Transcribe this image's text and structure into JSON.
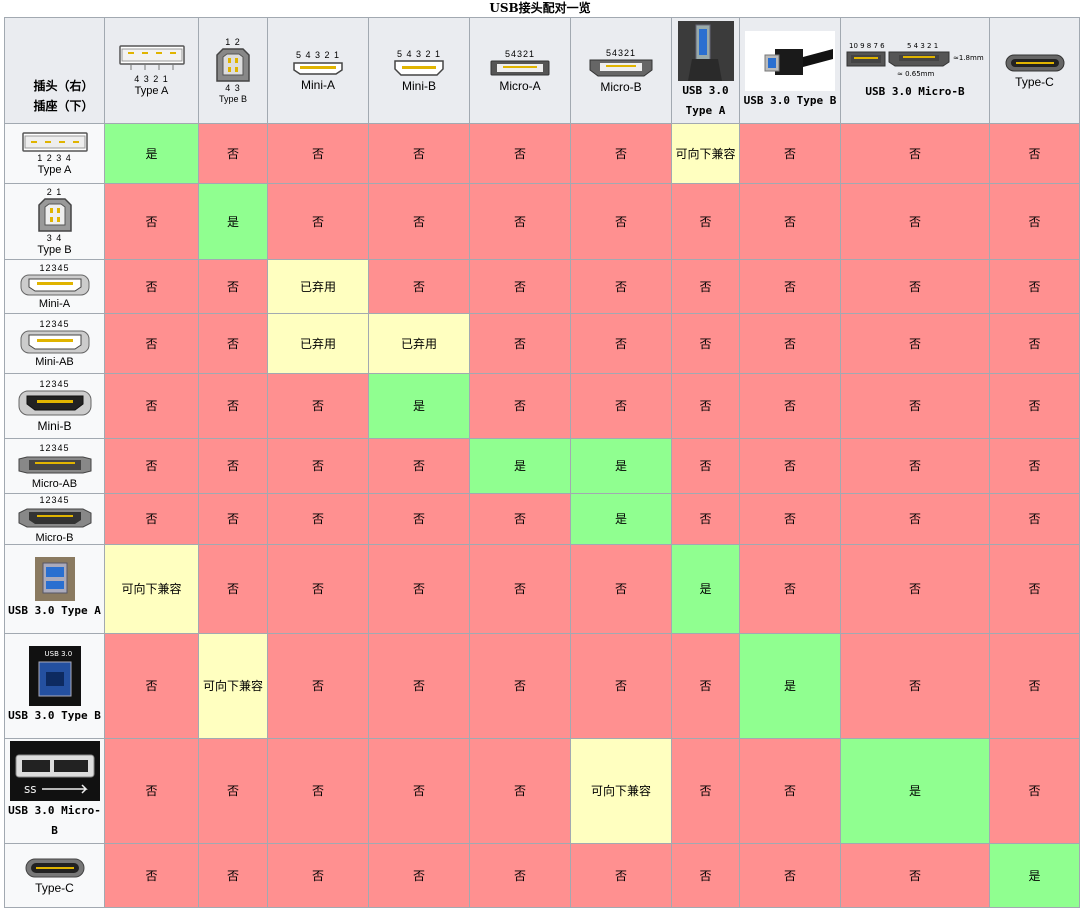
{
  "caption": "USB接头配对一览",
  "corner": {
    "line1": "插头（右）",
    "line2": "插座（下）"
  },
  "columns": [
    {
      "label": "Type A",
      "pins": "4 3 2 1",
      "icon": "usb-type-a-plug-icon"
    },
    {
      "label": "Type B",
      "pins_top": "1 2",
      "pins_bottom": "4 3",
      "icon": "usb-type-b-plug-icon"
    },
    {
      "label": "Mini-A",
      "pins": "5 4 3 2 1",
      "icon": "usb-mini-a-plug-icon"
    },
    {
      "label": "Mini-B",
      "pins": "5 4 3 2 1",
      "icon": "usb-mini-b-plug-icon"
    },
    {
      "label": "Micro-A",
      "pins": "54321",
      "icon": "usb-micro-a-plug-icon"
    },
    {
      "label": "Micro-B",
      "pins": "54321",
      "icon": "usb-micro-b-plug-icon"
    },
    {
      "label": "USB 3.0 Type A",
      "icon": "usb3-type-a-plug-photo"
    },
    {
      "label": "USB 3.0 Type B",
      "icon": "usb3-type-b-plug-photo"
    },
    {
      "label": "USB 3.0 Micro-B",
      "pins_left": "10 9 8 7 6",
      "pins_right": "5 4 3 2 1",
      "dim1": "≈1.8mm",
      "dim2": "≈ 0.65mm",
      "icon": "usb3-micro-b-plug-icon"
    },
    {
      "label": "Type-C",
      "icon": "usb-type-c-plug-icon"
    }
  ],
  "rows": [
    {
      "label": "Type A",
      "pins": "1 2 3 4",
      "icon": "usb-type-a-receptacle-icon",
      "cells": [
        [
          "是",
          "yes"
        ],
        [
          "否",
          "no"
        ],
        [
          "否",
          "no"
        ],
        [
          "否",
          "no"
        ],
        [
          "否",
          "no"
        ],
        [
          "否",
          "no"
        ],
        [
          "可向下兼容",
          "back"
        ],
        [
          "否",
          "no"
        ],
        [
          "否",
          "no"
        ],
        [
          "否",
          "no"
        ]
      ]
    },
    {
      "label": "Type B",
      "pins_top": "2 1",
      "pins_bottom": "3 4",
      "icon": "usb-type-b-receptacle-icon",
      "cells": [
        [
          "否",
          "no"
        ],
        [
          "是",
          "yes"
        ],
        [
          "否",
          "no"
        ],
        [
          "否",
          "no"
        ],
        [
          "否",
          "no"
        ],
        [
          "否",
          "no"
        ],
        [
          "否",
          "no"
        ],
        [
          "否",
          "no"
        ],
        [
          "否",
          "no"
        ],
        [
          "否",
          "no"
        ]
      ]
    },
    {
      "label": "Mini-A",
      "pins": "12345",
      "icon": "usb-mini-a-receptacle-icon",
      "cells": [
        [
          "否",
          "no"
        ],
        [
          "否",
          "no"
        ],
        [
          "已弃用",
          "depr"
        ],
        [
          "否",
          "no"
        ],
        [
          "否",
          "no"
        ],
        [
          "否",
          "no"
        ],
        [
          "否",
          "no"
        ],
        [
          "否",
          "no"
        ],
        [
          "否",
          "no"
        ],
        [
          "否",
          "no"
        ]
      ]
    },
    {
      "label": "Mini-AB",
      "pins": "12345",
      "icon": "usb-mini-ab-receptacle-icon",
      "cells": [
        [
          "否",
          "no"
        ],
        [
          "否",
          "no"
        ],
        [
          "已弃用",
          "depr"
        ],
        [
          "已弃用",
          "depr"
        ],
        [
          "否",
          "no"
        ],
        [
          "否",
          "no"
        ],
        [
          "否",
          "no"
        ],
        [
          "否",
          "no"
        ],
        [
          "否",
          "no"
        ],
        [
          "否",
          "no"
        ]
      ]
    },
    {
      "label": "Mini-B",
      "pins": "12345",
      "icon": "usb-mini-b-receptacle-icon",
      "cells": [
        [
          "否",
          "no"
        ],
        [
          "否",
          "no"
        ],
        [
          "否",
          "no"
        ],
        [
          "是",
          "yes"
        ],
        [
          "否",
          "no"
        ],
        [
          "否",
          "no"
        ],
        [
          "否",
          "no"
        ],
        [
          "否",
          "no"
        ],
        [
          "否",
          "no"
        ],
        [
          "否",
          "no"
        ]
      ]
    },
    {
      "label": "Micro-AB",
      "pins": "12345",
      "icon": "usb-micro-ab-receptacle-icon",
      "cells": [
        [
          "否",
          "no"
        ],
        [
          "否",
          "no"
        ],
        [
          "否",
          "no"
        ],
        [
          "否",
          "no"
        ],
        [
          "是",
          "yes"
        ],
        [
          "是",
          "yes"
        ],
        [
          "否",
          "no"
        ],
        [
          "否",
          "no"
        ],
        [
          "否",
          "no"
        ],
        [
          "否",
          "no"
        ]
      ]
    },
    {
      "label": "Micro-B",
      "pins": "12345",
      "icon": "usb-micro-b-receptacle-icon",
      "cells": [
        [
          "否",
          "no"
        ],
        [
          "否",
          "no"
        ],
        [
          "否",
          "no"
        ],
        [
          "否",
          "no"
        ],
        [
          "否",
          "no"
        ],
        [
          "是",
          "yes"
        ],
        [
          "否",
          "no"
        ],
        [
          "否",
          "no"
        ],
        [
          "否",
          "no"
        ],
        [
          "否",
          "no"
        ]
      ]
    },
    {
      "label": "USB 3.0 Type A",
      "icon": "usb3-type-a-receptacle-photo",
      "cells": [
        [
          "可向下兼容",
          "back"
        ],
        [
          "否",
          "no"
        ],
        [
          "否",
          "no"
        ],
        [
          "否",
          "no"
        ],
        [
          "否",
          "no"
        ],
        [
          "否",
          "no"
        ],
        [
          "是",
          "yes"
        ],
        [
          "否",
          "no"
        ],
        [
          "否",
          "no"
        ],
        [
          "否",
          "no"
        ]
      ]
    },
    {
      "label": "USB 3.0 Type B",
      "photo_text": "USB 3.0",
      "icon": "usb3-type-b-receptacle-photo",
      "cells": [
        [
          "否",
          "no"
        ],
        [
          "可向下兼容",
          "back"
        ],
        [
          "否",
          "no"
        ],
        [
          "否",
          "no"
        ],
        [
          "否",
          "no"
        ],
        [
          "否",
          "no"
        ],
        [
          "否",
          "no"
        ],
        [
          "是",
          "yes"
        ],
        [
          "否",
          "no"
        ],
        [
          "否",
          "no"
        ]
      ]
    },
    {
      "label": "USB 3.0 Micro-B",
      "icon": "usb3-micro-b-receptacle-photo",
      "cells": [
        [
          "否",
          "no"
        ],
        [
          "否",
          "no"
        ],
        [
          "否",
          "no"
        ],
        [
          "否",
          "no"
        ],
        [
          "否",
          "no"
        ],
        [
          "可向下兼容",
          "back"
        ],
        [
          "否",
          "no"
        ],
        [
          "否",
          "no"
        ],
        [
          "是",
          "yes"
        ],
        [
          "否",
          "no"
        ]
      ]
    },
    {
      "label": "Type-C",
      "icon": "usb-type-c-receptacle-icon",
      "cells": [
        [
          "否",
          "no"
        ],
        [
          "否",
          "no"
        ],
        [
          "否",
          "no"
        ],
        [
          "否",
          "no"
        ],
        [
          "否",
          "no"
        ],
        [
          "否",
          "no"
        ],
        [
          "否",
          "no"
        ],
        [
          "否",
          "no"
        ],
        [
          "否",
          "no"
        ],
        [
          "是",
          "yes"
        ]
      ]
    }
  ],
  "colors": {
    "yes": "#90ff90",
    "no": "#ff9090",
    "compatible": "#ffffc0",
    "header": "#eaecf0",
    "border": "#a2a9b1"
  }
}
